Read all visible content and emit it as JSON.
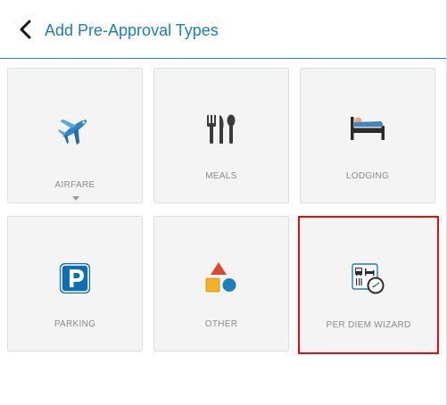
{
  "header": {
    "title": "Add Pre-Approval Types",
    "back_icon": "chevron-left-icon"
  },
  "tiles": [
    {
      "label": "AIRFARE",
      "icon": "airplane-icon",
      "has_dropdown": true
    },
    {
      "label": "MEALS",
      "icon": "fork-knife-icon"
    },
    {
      "label": "LODGING",
      "icon": "bed-icon"
    },
    {
      "label": "PARKING",
      "icon": "parking-icon"
    },
    {
      "label": "OTHER",
      "icon": "shapes-icon"
    },
    {
      "label": "PER DIEM WIZARD",
      "icon": "per-diem-icon",
      "selected": true
    }
  ],
  "colors": {
    "accent": "#1a7fb5",
    "tile_bg": "#f4f4f4",
    "label": "#8a8a8a",
    "selection": "#e01010"
  }
}
